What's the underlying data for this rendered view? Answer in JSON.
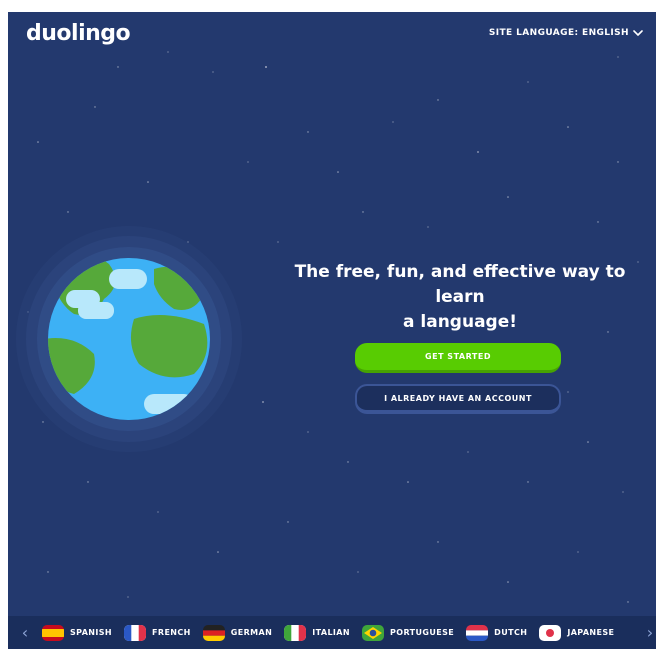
{
  "header": {
    "logo": "duolingo",
    "site_language_label": "SITE LANGUAGE: ENGLISH"
  },
  "hero": {
    "headline_line1": "The free, fun, and effective way to learn",
    "headline_line2": "a language!",
    "get_started_label": "GET STARTED",
    "have_account_label": "I ALREADY HAVE AN ACCOUNT"
  },
  "language_bar": {
    "prev_icon": "chevron-left-icon",
    "next_icon": "chevron-right-icon",
    "languages": [
      {
        "label": "SPANISH",
        "flag": "spain-flag-icon"
      },
      {
        "label": "FRENCH",
        "flag": "france-flag-icon"
      },
      {
        "label": "GERMAN",
        "flag": "germany-flag-icon"
      },
      {
        "label": "ITALIAN",
        "flag": "italy-flag-icon"
      },
      {
        "label": "PORTUGUESE",
        "flag": "brazil-flag-icon"
      },
      {
        "label": "DUTCH",
        "flag": "netherlands-flag-icon"
      },
      {
        "label": "JAPANESE",
        "flag": "japan-flag-icon"
      }
    ]
  },
  "colors": {
    "background": "#23396e",
    "primary_button": "#58cc02",
    "secondary_button_border": "#3b5596",
    "language_bar": "#1a2e5c"
  }
}
